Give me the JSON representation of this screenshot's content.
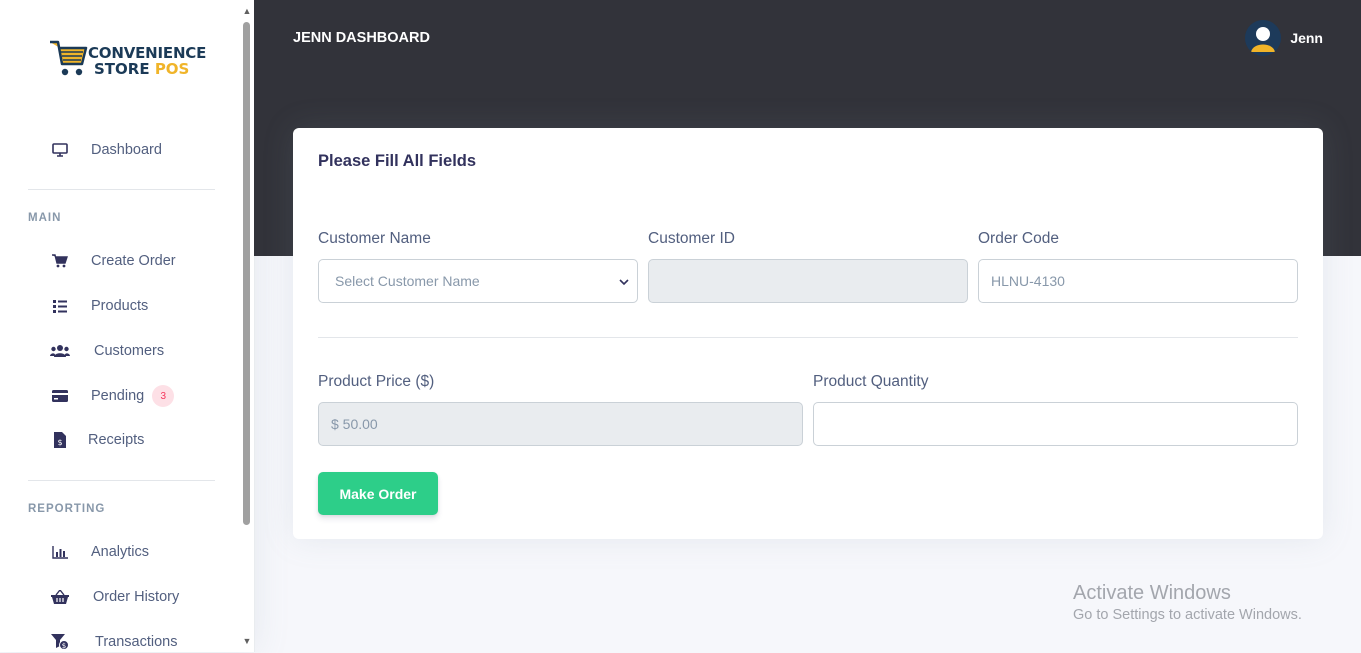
{
  "brand": {
    "line1": "CONVENIENCE",
    "line2_a": "STORE ",
    "line2_b": "POS"
  },
  "sidebar": {
    "dashboard": "Dashboard",
    "main_heading": "MAIN",
    "main_items": [
      {
        "label": "Create Order",
        "icon": "cart-icon"
      },
      {
        "label": "Products",
        "icon": "list-icon"
      },
      {
        "label": "Customers",
        "icon": "users-icon"
      },
      {
        "label": "Pending",
        "icon": "credit-card-icon",
        "badge": "3"
      },
      {
        "label": "Receipts",
        "icon": "invoice-icon"
      }
    ],
    "reporting_heading": "REPORTING",
    "reporting_items": [
      {
        "label": "Analytics",
        "icon": "bar-chart-icon"
      },
      {
        "label": "Order History",
        "icon": "basket-icon"
      },
      {
        "label": "Transactions",
        "icon": "filter-dollar-icon"
      }
    ]
  },
  "header": {
    "title": "JENN DASHBOARD",
    "user_name": "Jenn"
  },
  "form": {
    "title": "Please Fill All Fields",
    "customer_name_label": "Customer Name",
    "customer_name_selected": "Select Customer Name",
    "customer_id_label": "Customer ID",
    "customer_id_value": "",
    "order_code_label": "Order Code",
    "order_code_value": "HLNU-4130",
    "product_price_label": "Product Price ($)",
    "product_price_value": "$ 50.00",
    "product_quantity_label": "Product Quantity",
    "product_quantity_value": "",
    "submit_label": "Make Order"
  },
  "watermark": {
    "title": "Activate Windows",
    "subtitle": "Go to Settings to activate Windows."
  },
  "colors": {
    "accent_green": "#2dce89",
    "header_dark": "#32333a",
    "badge_red": "#f5365c"
  }
}
